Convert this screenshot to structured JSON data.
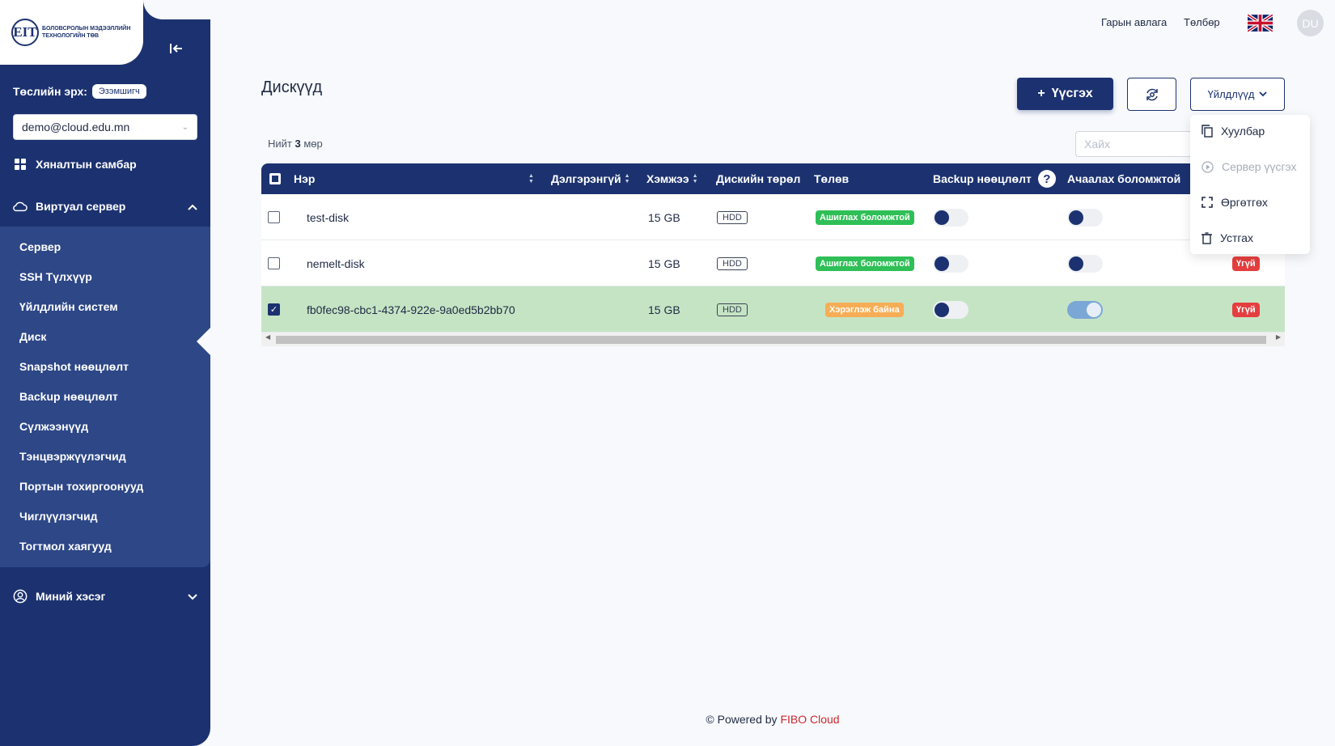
{
  "sidebar": {
    "logo_mark": "EIT",
    "logo_text": "Боловсролын мэдээллийн технологийн төв",
    "role_label": "Төслийн эрх:",
    "role_badge": "Эзэмшигч",
    "account": "demo@cloud.edu.mn",
    "nav": {
      "dashboard": "Хяналтын самбар",
      "virtual_server": "Виртуал сервер",
      "my_section": "Миний хэсэг"
    },
    "submenu": [
      "Сервер",
      "SSH Түлхүүр",
      "Үйлдлийн систем",
      "Диск",
      "Snapshot нөөцлөлт",
      "Backup нөөцлөлт",
      "Сүлжээнүүд",
      "Тэнцвэржүүлэгчид",
      "Портын тохиргоонууд",
      "Чиглүүлэгчид",
      "Тогтмол хаягууд"
    ]
  },
  "topbar": {
    "guide": "Гарын авлага",
    "payment": "Төлбөр",
    "avatar": "DU"
  },
  "page": {
    "title": "Дискүүд",
    "create": "Үүсгэх",
    "actions": "Үйлдлүүд",
    "count_prefix": "Нийт",
    "count": "3",
    "count_suffix": "мөр",
    "search_placeholder": "Хайх"
  },
  "table": {
    "headers": {
      "name": "Нэр",
      "details": "Дэлгэрэнгүй",
      "size": "Хэмжээ",
      "disk_type": "Дискийн төрөл",
      "status": "Төлөв",
      "backup": "Backup нөөцлөлт",
      "bootable": "Ачаалах боломжтой"
    },
    "rows": [
      {
        "name": "test-disk",
        "size": "15 GB",
        "type": "HDD",
        "status": "Ашиглах боломжтой",
        "last": ""
      },
      {
        "name": "nemelt-disk",
        "size": "15 GB",
        "type": "HDD",
        "status": "Ашиглах боломжтой",
        "last": "Үгүй"
      },
      {
        "name": "fb0fec98-cbc1-4374-922e-9a0ed5b2bb70",
        "size": "15 GB",
        "type": "HDD",
        "status": "Хэрэглэж байна",
        "last": "Үгүй"
      }
    ]
  },
  "dropdown": {
    "copy": "Хуулбар",
    "create_server": "Сервер үүсгэх",
    "extend": "Өргөтгөх",
    "delete": "Устгах"
  },
  "footer": {
    "prefix": "© Powered by",
    "brand": "FIBO Cloud"
  },
  "colors": {
    "primary": "#1c3270",
    "submenu": "#2d4787",
    "green": "#2fbf57",
    "orange": "#f6ad55",
    "red": "#e53e3e",
    "selected_row": "#c5e4c4"
  }
}
